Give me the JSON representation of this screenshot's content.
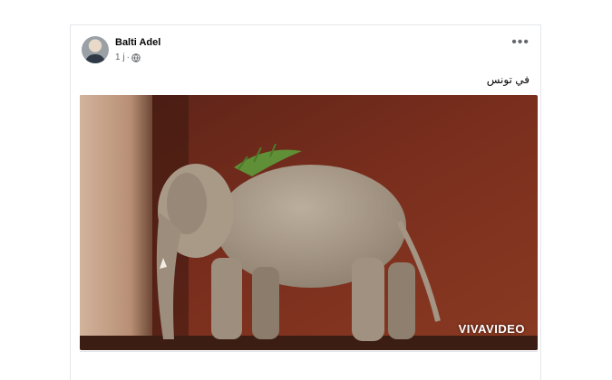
{
  "post": {
    "author": "Balti Adel",
    "time": "1 j",
    "separator": "·",
    "text": "في تونس",
    "more_icon": "more-options-icon",
    "audience_icon": "globe-icon"
  },
  "photo": {
    "watermark": "VIVAVIDEO",
    "colors": {
      "wall_left": "#c7a58c",
      "wall_back": "#7a2e1d",
      "elephant": "#a59684",
      "grass": "#5f8f36"
    }
  }
}
